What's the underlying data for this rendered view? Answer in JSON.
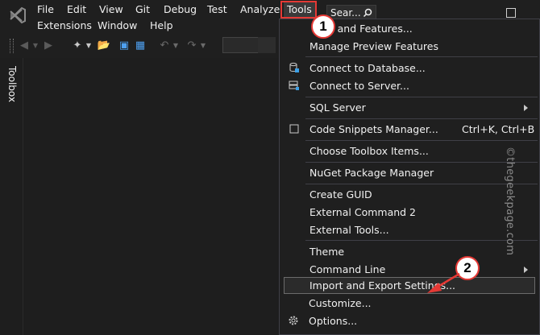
{
  "menubar": {
    "row1": [
      "File",
      "Edit",
      "View",
      "Git",
      "Debug",
      "Test",
      "Analyze",
      "Tools"
    ],
    "row2": [
      "Extensions",
      "Window",
      "Help"
    ],
    "search_label": "Sear..."
  },
  "toolbox": {
    "label": "Toolbox"
  },
  "tools_menu": {
    "items": [
      {
        "label": "Get Tools and Features...",
        "visible_label": "ols and Features..."
      },
      {
        "label": "Manage Preview Features"
      },
      {
        "label": "Connect to Database...",
        "icon": "database-connect-icon"
      },
      {
        "label": "Connect to Server...",
        "icon": "server-connect-icon"
      },
      {
        "label": "SQL Server",
        "submenu": true
      },
      {
        "label": "Code Snippets Manager...",
        "shortcut": "Ctrl+K, Ctrl+B",
        "icon": "snippet-icon"
      },
      {
        "label": "Choose Toolbox Items..."
      },
      {
        "label": "NuGet Package Manager",
        "submenu": true
      },
      {
        "label": "Create GUID"
      },
      {
        "label": "External Command 2"
      },
      {
        "label": "External Tools..."
      },
      {
        "label": "Theme",
        "submenu": true
      },
      {
        "label": "Command Line",
        "submenu": true
      },
      {
        "label": "Import and Export Settings...",
        "highlighted": true
      },
      {
        "label": "Customize..."
      },
      {
        "label": "Options...",
        "icon": "gear-icon"
      }
    ]
  },
  "annotations": {
    "badge1": "1",
    "badge2": "2"
  },
  "watermark": "©thegeekpage.com",
  "colors": {
    "background": "#1e1e1e",
    "menu_bg": "#1f1f1f",
    "highlight": "#2b2b2b",
    "annotation_red": "#e53935",
    "vs_purple": "#b180d7"
  }
}
